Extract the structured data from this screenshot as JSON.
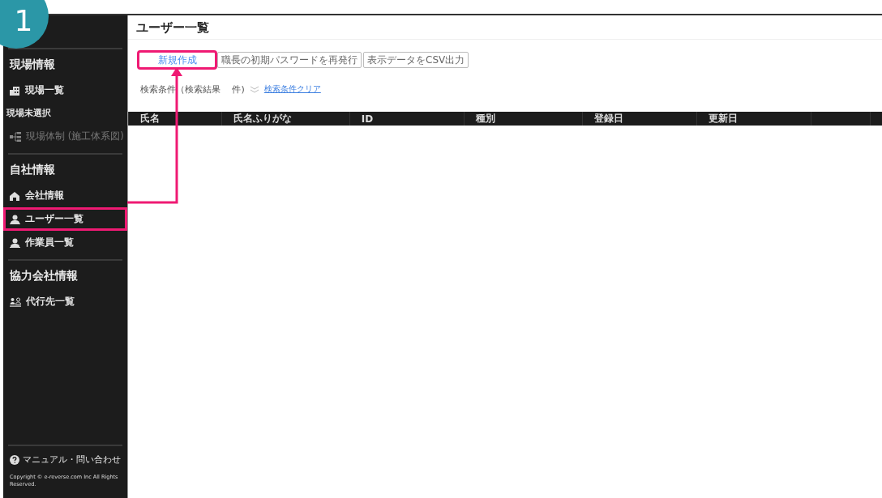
{
  "annotation": {
    "step": "1"
  },
  "sidebar": {
    "sections": [
      {
        "title": "現場情報",
        "items": [
          {
            "label": "現場一覧",
            "kind": "link",
            "disabled": false,
            "highlighted": false
          },
          {
            "label": "現場未選択",
            "kind": "note",
            "disabled": false,
            "highlighted": false
          },
          {
            "label": "現場体制 (施工体系図)",
            "kind": "link",
            "disabled": true,
            "highlighted": false
          }
        ]
      },
      {
        "title": "自社情報",
        "items": [
          {
            "label": "会社情報",
            "kind": "link",
            "disabled": false,
            "highlighted": false
          },
          {
            "label": "ユーザー一覧",
            "kind": "link",
            "disabled": false,
            "highlighted": true
          },
          {
            "label": "作業員一覧",
            "kind": "link",
            "disabled": false,
            "highlighted": false
          }
        ]
      },
      {
        "title": "協力会社情報",
        "items": [
          {
            "label": "代行先一覧",
            "kind": "link",
            "disabled": false,
            "highlighted": false
          }
        ]
      }
    ],
    "help": "マニュアル・問い合わせ",
    "copyright": "Copyright © e-reverse.com Inc All Rights Reserved."
  },
  "page": {
    "title": "ユーザー一覧",
    "buttons": [
      {
        "label": "新規作成",
        "kind": "primary",
        "highlighted": true
      },
      {
        "label": "職長の初期パスワードを再発行",
        "kind": "secondary",
        "highlighted": false
      },
      {
        "label": "表示データをCSV出力",
        "kind": "secondary",
        "highlighted": false
      }
    ],
    "search": {
      "label": "検索条件（検索結果　 件)",
      "clear": "検索条件クリア"
    },
    "table": {
      "columns": [
        "氏名",
        "氏名ふりがな",
        "ID",
        "種別",
        "登録日",
        "更新日",
        "",
        ""
      ]
    }
  }
}
